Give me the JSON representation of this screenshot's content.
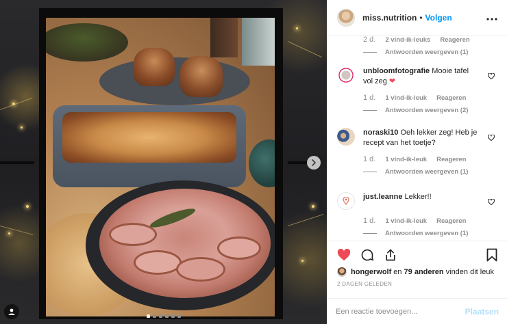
{
  "post": {
    "author": "miss.nutrition",
    "separator": "•",
    "follow_label": "Volgen",
    "more_icon": "more-horizontal-icon",
    "carousel": {
      "count": 6,
      "active_index": 0
    }
  },
  "comments": [
    {
      "time": "2 d.",
      "likes": "2 vind-ik-leuks",
      "reply": "Reageren",
      "view_replies": "Antwoorden weergeven (1)"
    },
    {
      "user": "unbloomfotografie",
      "text": "Mooie tafel vol zeg",
      "emoji": "heart",
      "time": "1 d.",
      "likes": "1 vind-ik-leuk",
      "reply": "Reageren",
      "view_replies": "Antwoorden weergeven (2)"
    },
    {
      "user": "noraski10",
      "text": "Oeh lekker zeg! Heb je recept van het toetje?",
      "time": "1 d.",
      "likes": "1 vind-ik-leuk",
      "reply": "Reageren",
      "view_replies": "Antwoorden weergeven (1)"
    },
    {
      "user": "just.leanne",
      "text": "Lekker!!",
      "time": "1 d.",
      "likes": "1 vind-ik-leuk",
      "reply": "Reageren",
      "view_replies": "Antwoorden weergeven (1)"
    }
  ],
  "likes_summary": {
    "user": "hongerwolf",
    "middle": "en",
    "others": "79 anderen",
    "suffix": "vinden dit leuk"
  },
  "posted_ago": "2 DAGEN GELEDEN",
  "composer": {
    "placeholder": "Een reactie toevoegen...",
    "post_label": "Plaatsen"
  },
  "colors": {
    "like_red": "#ed4956",
    "link_blue": "#0095f6",
    "muted": "#8e8e8e",
    "text": "#262626"
  }
}
